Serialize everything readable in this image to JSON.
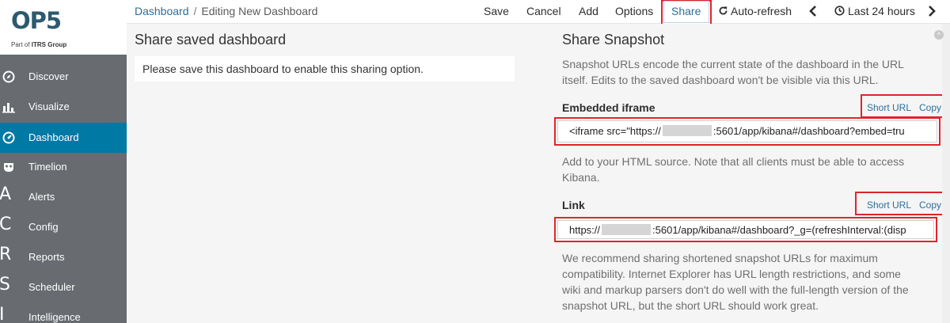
{
  "brand": {
    "logo": "OP5",
    "tagline_prefix": "Part of ",
    "tagline_bold": "ITRS Group"
  },
  "sidebar": {
    "items": [
      {
        "label": "Discover",
        "icon": "compass-icon"
      },
      {
        "label": "Visualize",
        "icon": "bar-chart-icon"
      },
      {
        "label": "Dashboard",
        "icon": "dashboard-icon",
        "active": true
      },
      {
        "label": "Timelion",
        "icon": "mask-icon"
      },
      {
        "label": "Alerts",
        "letter": "A"
      },
      {
        "label": "Config",
        "letter": "C"
      },
      {
        "label": "Reports",
        "letter": "R"
      },
      {
        "label": "Scheduler",
        "letter": "S"
      },
      {
        "label": "Intelligence",
        "letter": "I"
      }
    ]
  },
  "topbar": {
    "breadcrumb_link": "Dashboard",
    "breadcrumb_sep": "/",
    "breadcrumb_current": "Editing New Dashboard",
    "save": "Save",
    "cancel": "Cancel",
    "add": "Add",
    "options": "Options",
    "share": "Share",
    "autorefresh": "Auto-refresh",
    "time_range": "Last 24 hours",
    "prev_icon": "chevron-left-icon",
    "next_icon": "chevron-right-icon",
    "refresh_icon": "refresh-icon",
    "clock_icon": "clock-icon"
  },
  "left_panel": {
    "title": "Share saved dashboard",
    "message": "Please save this dashboard to enable this sharing option."
  },
  "right_panel": {
    "title": "Share Snapshot",
    "description_1": "Snapshot URLs encode the current state of the dashboard in the URL",
    "description_2": "itself. Edits to the saved dashboard won't be visible via this URL.",
    "embedded": {
      "label": "Embedded iframe",
      "short_url": "Short URL",
      "copy": "Copy",
      "value_prefix": "<iframe src=\"https://",
      "value_suffix": ":5601/app/kibana#/dashboard?embed=tru",
      "help_1": "Add to your HTML source. Note that all clients must be able to access",
      "help_2": "Kibana."
    },
    "link": {
      "label": "Link",
      "short_url": "Short URL",
      "copy": "Copy",
      "value_prefix": "https://",
      "value_suffix": ":5601/app/kibana#/dashboard?_g=(refreshInterval:(disp",
      "help_1": "We recommend sharing shortened snapshot URLs for maximum",
      "help_2": "compatibility. Internet Explorer has URL length restrictions, and some",
      "help_3": "wiki and markup parsers don't do well with the full-length version of the",
      "help_4": "snapshot URL, but the short URL should work great."
    }
  },
  "colors": {
    "sidebar_bg": "#686b70",
    "active_bg": "#0079a5",
    "highlight": "#e0242a",
    "link": "#2d6e9a"
  }
}
